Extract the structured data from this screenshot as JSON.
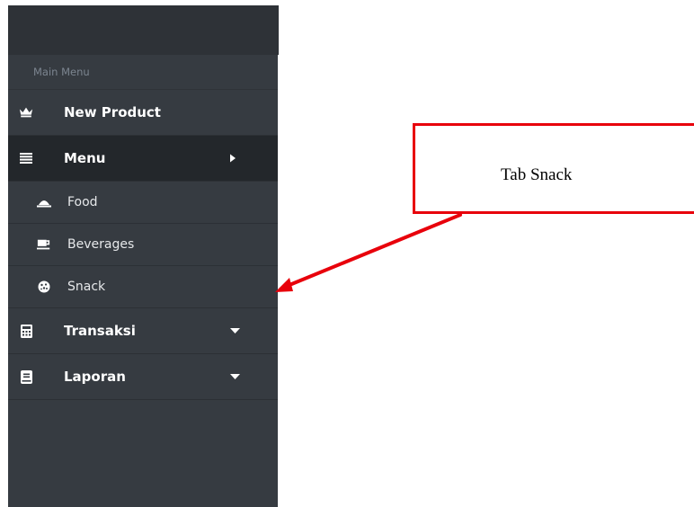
{
  "sidebar": {
    "header_label": "Main Menu",
    "items": [
      {
        "label": "New Product",
        "icon": "crown-icon"
      },
      {
        "label": "Menu",
        "icon": "list-icon",
        "caret": "caret-right-icon",
        "active": true
      },
      {
        "label": "Transaksi",
        "icon": "calculator-icon",
        "caret": "caret-down-icon"
      },
      {
        "label": "Laporan",
        "icon": "book-icon",
        "caret": "caret-down-icon"
      }
    ],
    "submenu": [
      {
        "label": "Food",
        "icon": "food-cover-icon"
      },
      {
        "label": "Beverages",
        "icon": "cup-icon"
      },
      {
        "label": "Snack",
        "icon": "cookie-icon"
      }
    ]
  },
  "annotation": {
    "callout_text": "Tab Snack",
    "border_color": "#e8000b",
    "arrow_color": "#e8000b"
  },
  "colors": {
    "sidebar_bg": "#363b41",
    "active_bg": "#23272b",
    "text": "#ffffff",
    "muted_text": "#7c8590"
  }
}
